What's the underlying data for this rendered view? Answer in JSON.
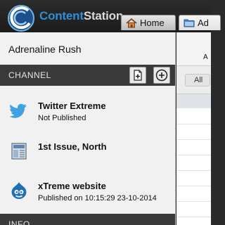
{
  "header": {
    "brand_part1": "Content",
    "brand_part2": "Station",
    "tabs": [
      {
        "label": "Home",
        "icon": "house-icon"
      },
      {
        "label": "Ad",
        "icon": "folder-icon"
      }
    ]
  },
  "panel": {
    "title": "Adrenaline Rush",
    "channel_label": "CHANNEL",
    "info_label": "INFO",
    "channels": [
      {
        "name": "Twitter Extreme",
        "status": "Not Published",
        "icon": "twitter-bird-icon"
      },
      {
        "name": "1st Issue, North",
        "status": "",
        "icon": "print-issue-icon"
      },
      {
        "name": "xTreme website",
        "status": "Published on 10:15:29 23-10-2014",
        "icon": "drupal-icon"
      }
    ]
  },
  "right": {
    "cut_label": "A",
    "filter_all": "All"
  },
  "colors": {
    "brand_blue": "#2e8fd6",
    "section_bar": "#3a3a3a",
    "panel_bg": "#f1f1f1"
  }
}
